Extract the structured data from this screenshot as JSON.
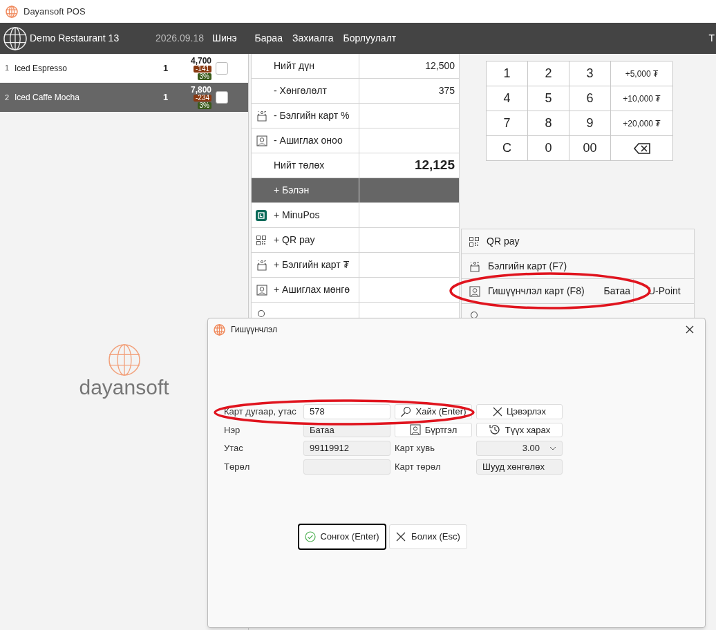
{
  "app_title": "Dayansoft POS",
  "header": {
    "restaurant": "Demo Restaurant 13",
    "date": "2026.09.18",
    "nav": [
      {
        "label": "Шинэ"
      },
      {
        "label": "Бараа"
      },
      {
        "label": "Захиалга"
      },
      {
        "label": "Борлуулалт"
      },
      {
        "label": "Т"
      }
    ]
  },
  "order_items": [
    {
      "index": "1",
      "name": "Iced Espresso",
      "qty": "1",
      "price": "4,700",
      "discount": "-141",
      "percent": "3%",
      "selected": false
    },
    {
      "index": "2",
      "name": "Iced Caffe Mocha",
      "qty": "1",
      "price": "7,800",
      "discount": "-234",
      "percent": "3%",
      "selected": true
    }
  ],
  "brand": "dayansoft",
  "payment_rows": [
    {
      "label": "Нийт дүн",
      "value": "12,500",
      "kind": "plain",
      "selected": false
    },
    {
      "label": "- Хөнгөлөлт",
      "value": "375",
      "kind": "plain",
      "selected": false
    },
    {
      "label": "- Бэлгийн карт %",
      "kind": "gift",
      "selected": false
    },
    {
      "label": "- Ашиглах оноо",
      "kind": "member",
      "selected": false
    },
    {
      "label": "Нийт төлөх",
      "value": "12,125",
      "kind": "total",
      "selected": false
    },
    {
      "label": "+ Бэлэн",
      "kind": "cash",
      "selected": true
    },
    {
      "label": "+ MinuPos",
      "kind": "minupos",
      "selected": false
    },
    {
      "label": "+ QR pay",
      "kind": "qr",
      "selected": false
    },
    {
      "label": "+ Бэлгийн карт ₮",
      "kind": "gift",
      "selected": false
    },
    {
      "label": "+ Ашиглах мөнгө",
      "kind": "member",
      "selected": false
    },
    {
      "kind": "contact",
      "selected": false
    }
  ],
  "numpad": [
    "1",
    "2",
    "3",
    "+5,000 ₮",
    "4",
    "5",
    "6",
    "+10,000 ₮",
    "7",
    "8",
    "9",
    "+20,000 ₮",
    "C",
    "0",
    "00"
  ],
  "payment_options": [
    {
      "label": "QR pay",
      "kind": "qr"
    },
    {
      "label": "Бэлгийн карт (F7)",
      "kind": "gift"
    },
    {
      "label": "Гишүүнчлэл карт (F8)",
      "value": "Батаа",
      "extra": "U-Point",
      "kind": "member"
    },
    {
      "kind": "contact"
    }
  ],
  "dialog": {
    "title": "Гишүүнчлэл",
    "card_field": {
      "label": "Карт дугаар, утас",
      "value": "578"
    },
    "search_button": "Хайх (Enter)",
    "clear_button": "Цэвэрлэх",
    "name_field": {
      "label": "Нэр",
      "value": "Батаа"
    },
    "register_button": "Бүртгэл",
    "history_button": "Түүх харах",
    "phone_field": {
      "label": "Утас",
      "value": "99119912"
    },
    "card_rate": {
      "label": "Карт хувь",
      "value": "3.00"
    },
    "type_field": {
      "label": "Төрөл"
    },
    "card_type": {
      "label": "Карт төрөл",
      "value": "Шууд хөнгөлөх"
    },
    "ok_button": "Сонгох (Enter)",
    "cancel_button": "Болих (Esc)"
  }
}
